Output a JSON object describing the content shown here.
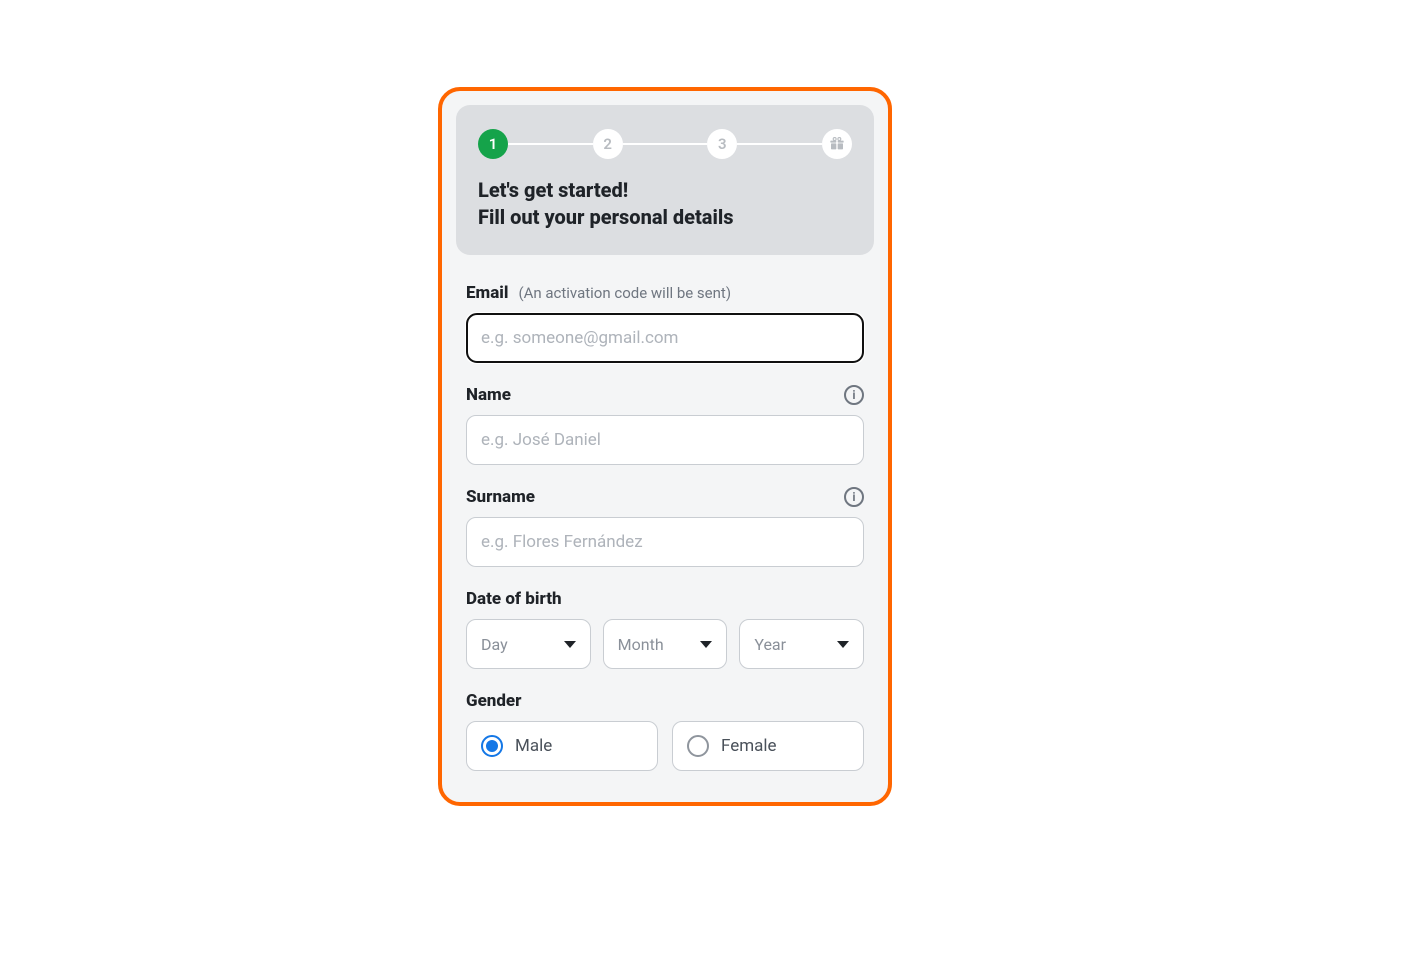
{
  "stepper": {
    "steps": {
      "s1": "1",
      "s2": "2",
      "s3": "3"
    },
    "title_line1": "Let's get started!",
    "title_line2": "Fill out your personal details"
  },
  "email": {
    "label": "Email",
    "hint": "(An activation code will be sent)",
    "placeholder": "e.g. someone@gmail.com",
    "value": ""
  },
  "name": {
    "label": "Name",
    "placeholder": "e.g. José Daniel",
    "value": ""
  },
  "surname": {
    "label": "Surname",
    "placeholder": "e.g. Flores Fernández",
    "value": ""
  },
  "dob": {
    "label": "Date of birth",
    "day": "Day",
    "month": "Month",
    "year": "Year"
  },
  "gender": {
    "label": "Gender",
    "male": "Male",
    "female": "Female",
    "selected": "male"
  }
}
